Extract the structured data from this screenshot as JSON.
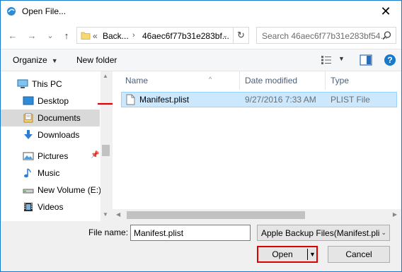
{
  "window": {
    "title": "Open File...",
    "close_glyph": "✕",
    "accent_color": "#1979ca"
  },
  "nav": {
    "back_glyph": "←",
    "forward_glyph": "→",
    "recent_glyph": "⌄",
    "up_glyph": "↑",
    "address": {
      "prefix": "«",
      "segment_1": "Back...",
      "separator": "›",
      "segment_2": "46aec6f77b31e283bf...",
      "dropdown_glyph": "⌄",
      "refresh_glyph": "↻"
    },
    "search_placeholder": "Search 46aec6f77b31e283bf54..."
  },
  "toolbar": {
    "organize_label": "Organize",
    "organize_caret": "▼",
    "new_folder_label": "New folder",
    "views_caret": "▼",
    "help_glyph": "?"
  },
  "sidebar": {
    "items": [
      {
        "label": "This PC",
        "icon": "computer-icon"
      },
      {
        "label": "Desktop",
        "icon": "desktop-icon"
      },
      {
        "label": "Documents",
        "icon": "documents-icon",
        "selected": true
      },
      {
        "label": "Downloads",
        "icon": "download-icon"
      },
      {
        "label": "Pictures",
        "icon": "pictures-icon",
        "pinned": true
      },
      {
        "label": "Music",
        "icon": "music-icon"
      },
      {
        "label": "New Volume (E:)",
        "icon": "drive-icon"
      },
      {
        "label": "Videos",
        "icon": "videos-icon"
      }
    ],
    "pin_glyph": "📌"
  },
  "file_list": {
    "columns": [
      "Name",
      "Date modified",
      "Type"
    ],
    "sort_glyph": "^",
    "rows": [
      {
        "name": "Manifest.plist",
        "date_modified": "9/27/2016 7:33 AM",
        "type": "PLIST File",
        "selected": true
      }
    ]
  },
  "bottom": {
    "file_name_label": "File name:",
    "file_name_value": "Manifest.plist",
    "file_type_value": "Apple Backup Files(Manifest.pli",
    "file_type_caret": "⌄",
    "open_label": "Open",
    "open_caret": "▼",
    "cancel_label": "Cancel"
  },
  "annotation": {
    "arrow_color": "#e00000",
    "highlight_color": "#e00000"
  }
}
